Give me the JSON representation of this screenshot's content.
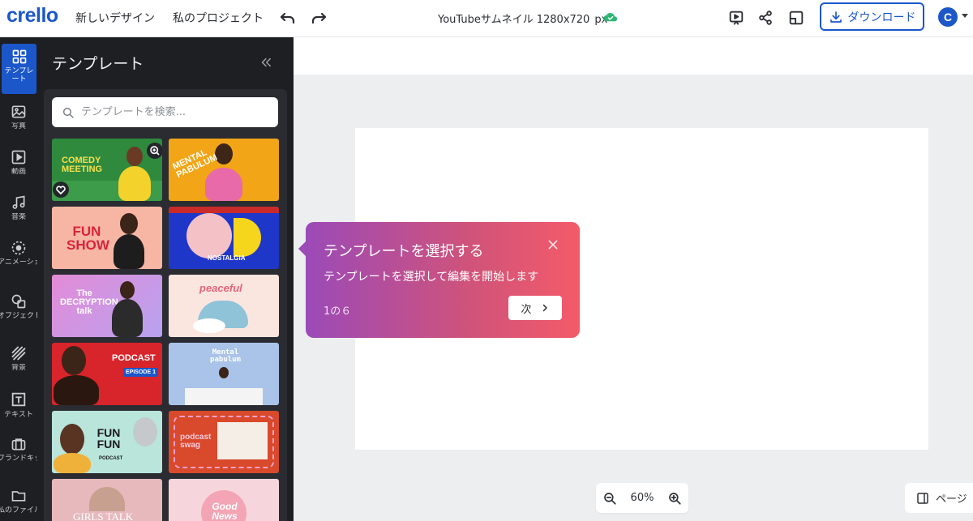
{
  "app": {
    "logo": "crello"
  },
  "header": {
    "new_design": "新しいデザイン",
    "my_projects": "私のプロジェクト",
    "doc_title": "YouTubeサムネイル 1280x720",
    "doc_unit": "px",
    "download_label": "ダウンロード",
    "avatar_initial": "C"
  },
  "rail": {
    "items": [
      {
        "label": "テンプレート",
        "icon": "grid-icon"
      },
      {
        "label": "写真",
        "icon": "photo-icon"
      },
      {
        "label": "動画",
        "icon": "video-icon"
      },
      {
        "label": "音楽",
        "icon": "music-icon"
      },
      {
        "label": "アニメーション",
        "icon": "animation-icon"
      },
      {
        "label": "オブジェクト",
        "icon": "shapes-icon"
      },
      {
        "label": "背景",
        "icon": "background-icon"
      },
      {
        "label": "テキスト",
        "icon": "text-icon"
      },
      {
        "label": "ブランドキット",
        "icon": "briefcase-icon"
      },
      {
        "label": "私のファイル",
        "icon": "folder-icon"
      }
    ]
  },
  "panel": {
    "title": "テンプレート",
    "search_placeholder": "テンプレートを検索...",
    "templates": [
      {
        "text": "COMEDY MEETING",
        "bg": "#2f8a3e"
      },
      {
        "text": "MENTAL PABULUM",
        "bg": "#f2a516"
      },
      {
        "text": "FUN SHOW",
        "bg": "#f7b6a4"
      },
      {
        "text": "NOSTALGIA",
        "bg": "#1f37c9"
      },
      {
        "text": "The DECRYPTION talk",
        "bg": "#e38bd6"
      },
      {
        "text": "peaceful",
        "bg": "#fbe6df"
      },
      {
        "text": "PODCAST",
        "sub": "EPISODE 1",
        "bg": "#d8242b"
      },
      {
        "text": "Mental pabulum",
        "bg": "#a9c4e8"
      },
      {
        "text": "FUN FUN",
        "sub": "PODCAST",
        "bg": "#b9e5db"
      },
      {
        "text": "podcast swag",
        "bg": "#d9492b"
      },
      {
        "text": "GIRLS TALK",
        "bg": "#e7b9bd"
      },
      {
        "text": "Good News",
        "bg": "#f6d6dc"
      }
    ]
  },
  "canvas": {
    "zoom": "60%",
    "pages_label": "ページ"
  },
  "tooltip": {
    "title": "テンプレートを選択する",
    "body": "テンプレートを選択して編集を開始します",
    "step": "1の６",
    "next_label": "次"
  },
  "colors": {
    "brand": "#1b57c9",
    "rail_bg": "#1d1f23",
    "tooltip_start": "#9b4ab8",
    "tooltip_end": "#f45b69"
  }
}
